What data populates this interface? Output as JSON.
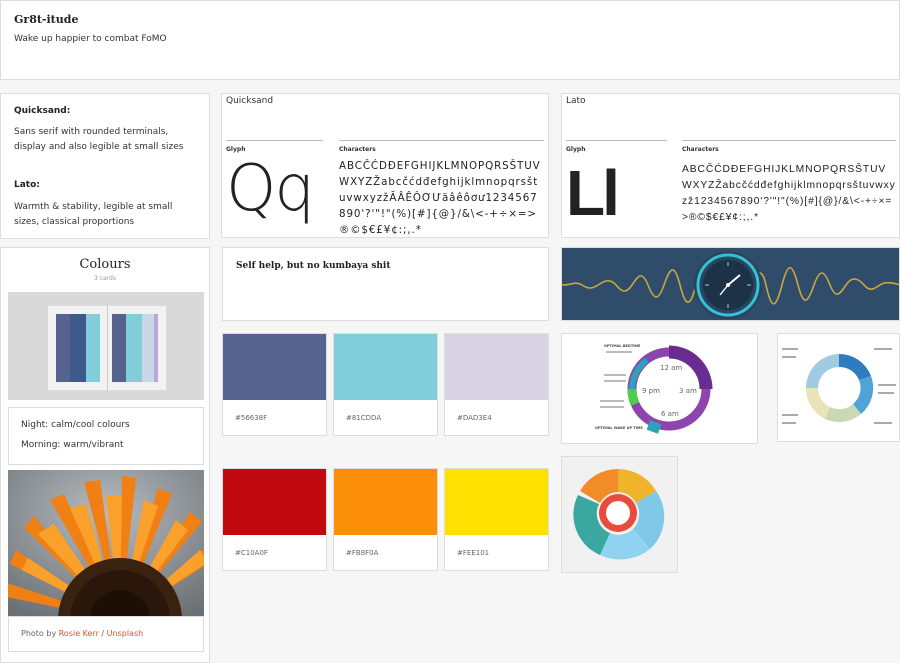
{
  "header": {
    "title": "Gr8t-itude",
    "subtitle": "Wake up happier to combat FoMO"
  },
  "fonts_note": {
    "quicksand_title": "Quicksand:",
    "quicksand_desc": "Sans serif with rounded terminals, display and also legible at small sizes",
    "lato_title": "Lato:",
    "lato_desc": "Warmth & stability, legible at small sizes, classical proportions"
  },
  "font_cards": [
    {
      "name": "Quicksand",
      "glyph_label": "Glyph",
      "chars_label": "Characters",
      "glyph": "Qq",
      "chars": "ABCČĆDĐEFGHIJKLMNOPQRSŠTUVWXYZŽabcčćdđefghijklmnopqrsštuvwxyzžĂÂÊÔƠƯăâêôơư1234567890'?'\"!\"(%)[#]{@}/&\\<-+÷×=>®©$€£¥¢:;,.*"
    },
    {
      "name": "Lato",
      "glyph_label": "Glyph",
      "chars_label": "Characters",
      "glyph": "Ll",
      "chars": "ABCČĆDĐEFGHIJKLMNOPQRSŠTUVWXYZŽabcčćdđefghijklmnopqrsštuvwxyzž1234567890'?'\"!\"(%)[#]{@}/&\\<-+÷×=>®©$€£¥¢:;,.*"
    }
  ],
  "colours_card": {
    "title": "Colours",
    "count": "3 cards"
  },
  "night_note": {
    "line1": "Night: calm/cool colours",
    "line2": "Morning: warm/vibrant"
  },
  "photo_credit": {
    "prefix": "Photo by ",
    "author": "Rosie Kerr",
    "sep": " / ",
    "site": "Unsplash"
  },
  "tagline": "Self help, but no kumbaya shit",
  "swatches": [
    {
      "hex": "#56638F",
      "color": "#56638F"
    },
    {
      "hex": "#81CDDA",
      "color": "#81CDDA"
    },
    {
      "hex": "#DAD3E4",
      "color": "#DAD3E4"
    },
    {
      "hex": "#C10A0F",
      "color": "#C10A0F"
    },
    {
      "hex": "#FB8F0A",
      "color": "#FB8F0A"
    },
    {
      "hex": "#FEE101",
      "color": "#FEE101"
    }
  ],
  "clock_chart": {
    "hours": [
      "12 am",
      "3 am",
      "6 am",
      "9 pm"
    ],
    "label_top": "OPTIMAL BEDTIME",
    "label_bottom": "OPTIMAL WAKE UP TIME"
  },
  "icons": {
    "clock": "clock-icon"
  }
}
